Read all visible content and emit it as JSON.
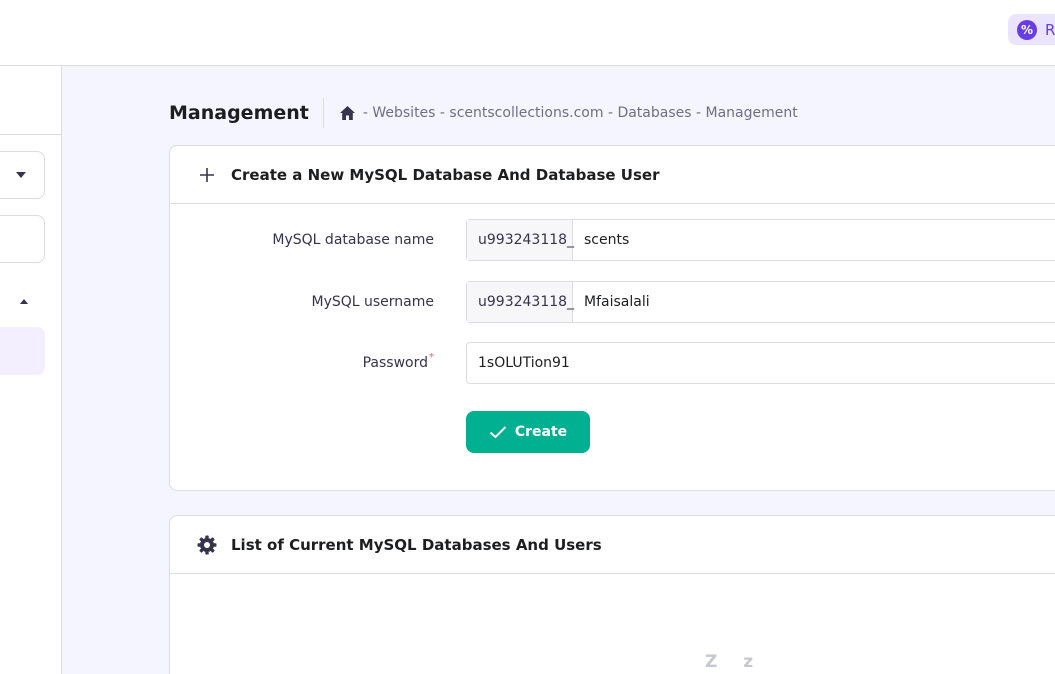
{
  "topbar": {
    "promo_text": "Refer"
  },
  "header": {
    "title": "Management",
    "breadcrumb": "- Websites - scentscollections.com - Databases - Management"
  },
  "create_section": {
    "title": "Create a New MySQL Database And Database User",
    "db_name_label": "MySQL database name",
    "db_prefix": "u993243118_",
    "db_name_value": "scents",
    "username_label": "MySQL username",
    "username_prefix": "u993243118_",
    "username_value": "Mfaisalali",
    "password_label": "Password",
    "password_required_mark": "*",
    "password_value": "1sOLUTion91",
    "create_button": "Create"
  },
  "list_section": {
    "title": "List of Current MySQL Databases And Users",
    "empty_art": "Z z"
  },
  "icons": [
    "percent-badge-icon",
    "chevron-down-icon",
    "chevron-up-icon",
    "home-icon",
    "plus-icon",
    "check-icon",
    "gear-icon"
  ],
  "colors": {
    "accent": "#673de6",
    "success": "#00b090",
    "background": "#f4f5ff"
  }
}
